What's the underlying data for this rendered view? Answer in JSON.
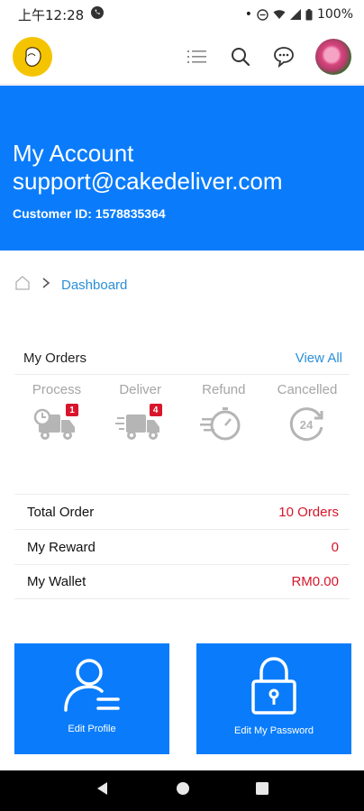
{
  "status": {
    "time": "上午12:28",
    "battery": "100%"
  },
  "header": {
    "logo_icon": "cake-logo-icon",
    "actions": [
      "menu-icon",
      "search-icon",
      "chat-icon",
      "avatar"
    ],
    "brand_color": "#f5c400"
  },
  "hero": {
    "title": "My Account",
    "email": "support@cakedeliver.com",
    "customer_id": "Customer ID: 1578835364",
    "bg_color": "#0a7cfb"
  },
  "breadcrumb": {
    "current": "Dashboard"
  },
  "orders": {
    "title": "My Orders",
    "view_all": "View All",
    "statuses": [
      {
        "label": "Process",
        "badge": "1",
        "icon": "process-truck-icon"
      },
      {
        "label": "Deliver",
        "badge": "4",
        "icon": "delivery-truck-icon"
      },
      {
        "label": "Refund",
        "badge": "",
        "icon": "refund-timer-icon"
      },
      {
        "label": "Cancelled",
        "badge": "",
        "icon": "cancelled-24-icon"
      }
    ]
  },
  "summary": [
    {
      "label": "Total Order",
      "value": "10 Orders"
    },
    {
      "label": "My Reward",
      "value": "0"
    },
    {
      "label": "My Wallet",
      "value": "RM0.00"
    }
  ],
  "tiles": [
    {
      "label": "Edit Profile",
      "icon": "user-profile-icon"
    },
    {
      "label": "Edit My Password",
      "icon": "padlock-icon"
    }
  ],
  "accent_red": "#d8152b",
  "link_color": "#2a8fd8"
}
